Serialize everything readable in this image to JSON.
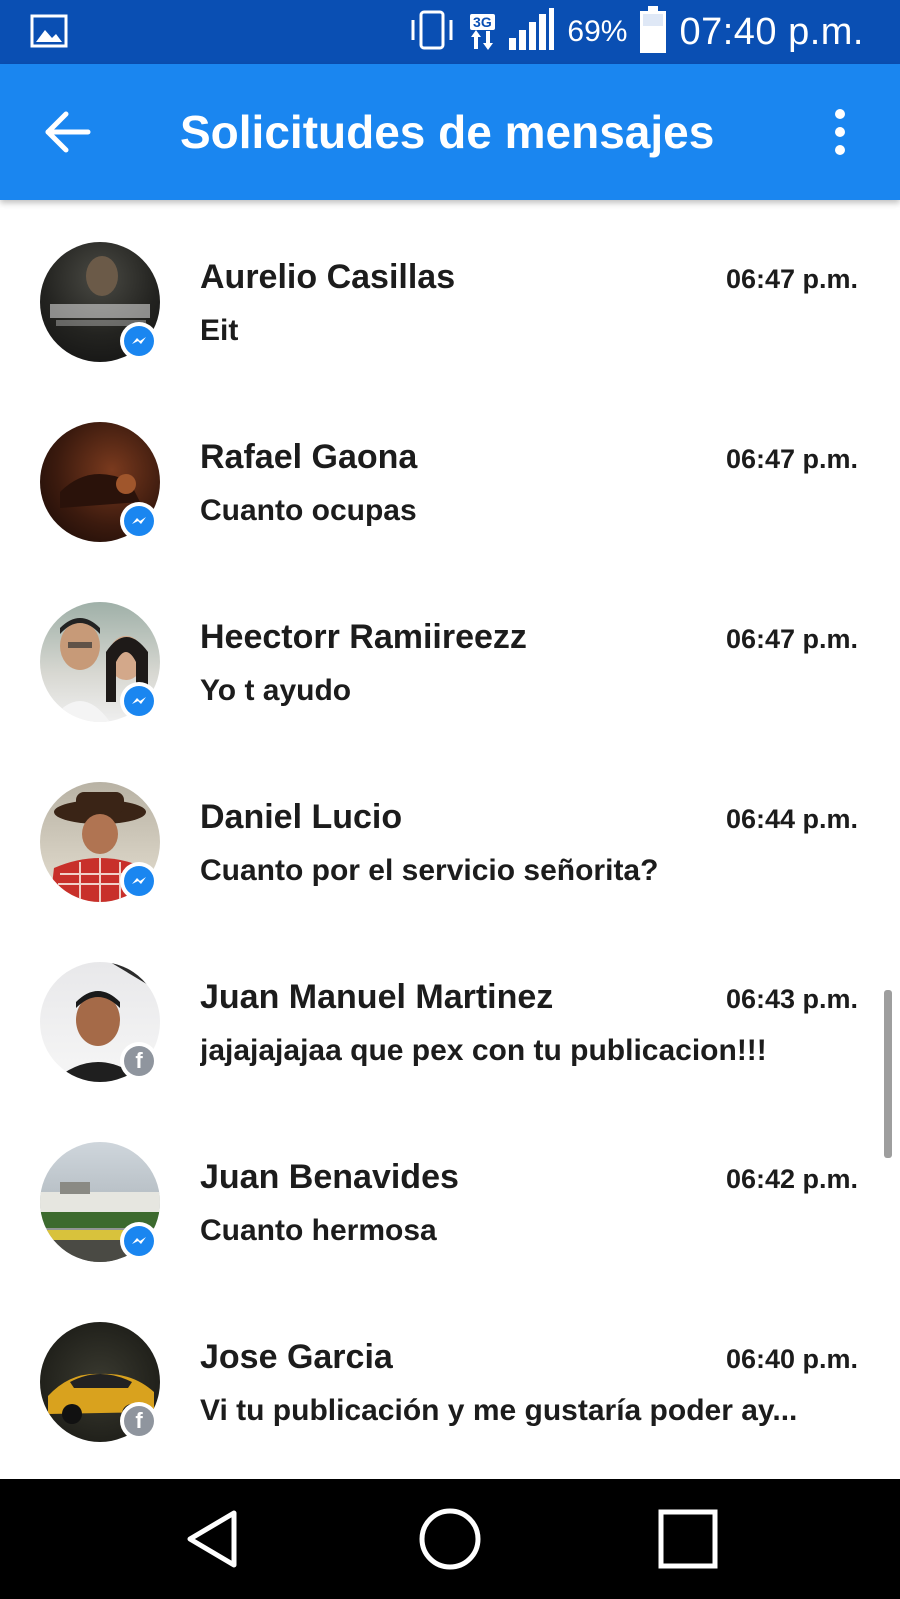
{
  "status_bar": {
    "network": "3G",
    "battery_percent": "69%",
    "time": "07:40 p.m.",
    "icons": [
      "image-icon",
      "vibrate-icon",
      "network-3g-icon",
      "signal-icon",
      "battery-icon"
    ]
  },
  "app_bar": {
    "title": "Solicitudes de mensajes",
    "back_icon": "arrow-back-icon",
    "menu_icon": "more-vert-icon"
  },
  "colors": {
    "status_bar": "#0a4fb3",
    "app_bar": "#1a86f0",
    "messenger_badge": "#1a86f0",
    "facebook_badge": "#8f959e",
    "nav_bar": "#000000"
  },
  "requests": [
    {
      "name": "Aurelio Casillas",
      "time": "06:47 p.m.",
      "message": "Eit",
      "badge": "messenger-icon"
    },
    {
      "name": "Rafael Gaona",
      "time": "06:47 p.m.",
      "message": "Cuanto ocupas",
      "badge": "messenger-icon"
    },
    {
      "name": "Heectorr Ramiireezz",
      "time": "06:47 p.m.",
      "message": "Yo t ayudo",
      "badge": "messenger-icon"
    },
    {
      "name": "Daniel Lucio",
      "time": "06:44 p.m.",
      "message": "Cuanto por el servicio señorita?",
      "badge": "messenger-icon"
    },
    {
      "name": "Juan Manuel Martinez",
      "time": "06:43 p.m.",
      "message": "jajajajajaa que pex con tu publicacion!!!",
      "badge": "facebook-icon"
    },
    {
      "name": "Juan Benavides",
      "time": "06:42 p.m.",
      "message": "Cuanto hermosa",
      "badge": "messenger-icon"
    },
    {
      "name": "Jose Garcia",
      "time": "06:40 p.m.",
      "message": "Vi tu publicación y me gustaría poder ay...",
      "badge": "facebook-icon"
    }
  ],
  "nav_bar": {
    "buttons": [
      "back-triangle-icon",
      "home-circle-icon",
      "recents-square-icon"
    ]
  }
}
